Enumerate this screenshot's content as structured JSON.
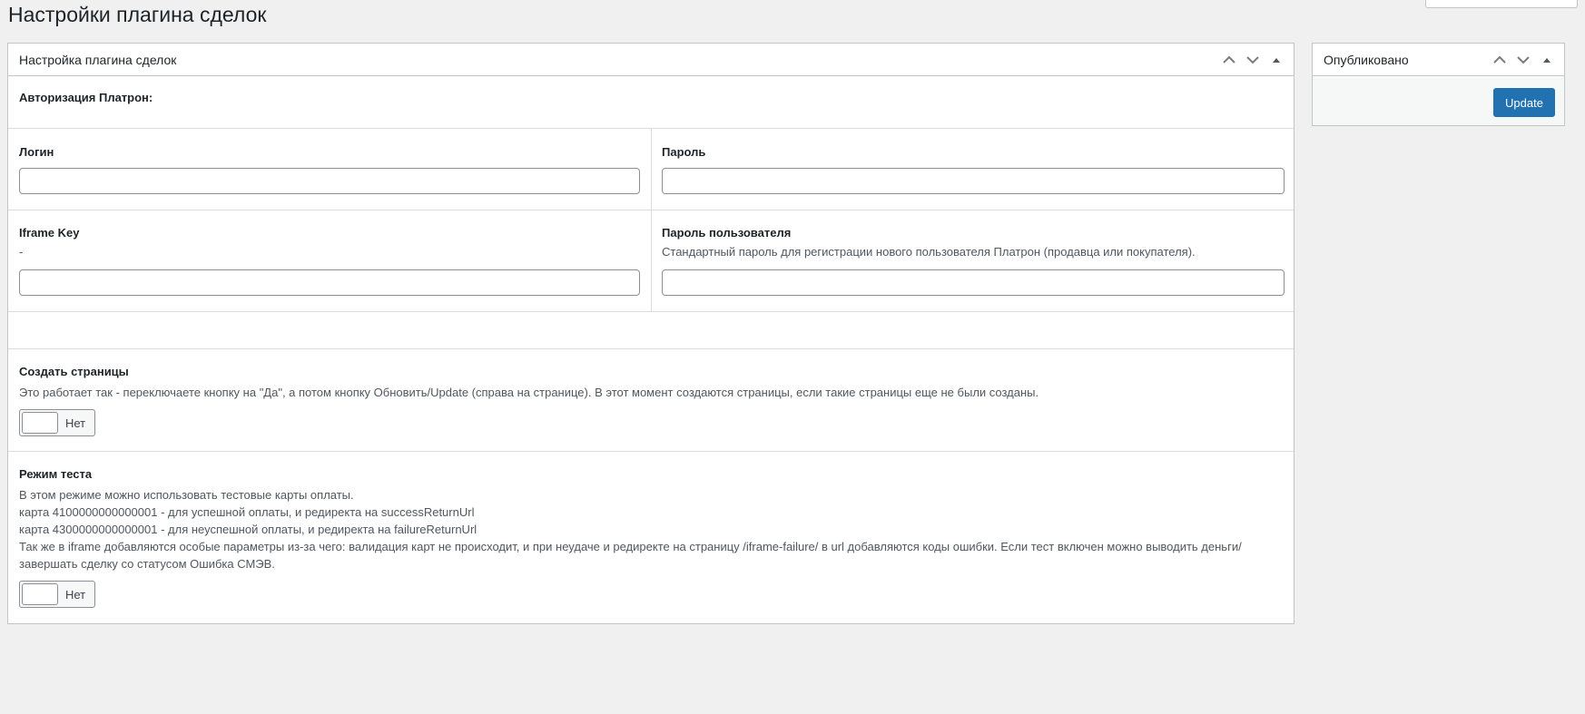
{
  "page": {
    "title": "Настройки плагина сделок"
  },
  "main_box": {
    "title": "Настройка плагина сделок",
    "auth_heading": "Авторизация Платрон:",
    "login": {
      "label": "Логин",
      "value": ""
    },
    "password": {
      "label": "Пароль",
      "value": ""
    },
    "iframe_key": {
      "label": "Iframe Key",
      "desc": "-",
      "value": ""
    },
    "user_password": {
      "label": "Пароль пользователя",
      "desc": "Стандартный пароль для регистрации нового пользователя Платрон (продавца или покупателя).",
      "value": ""
    },
    "create_pages": {
      "label": "Создать страницы",
      "desc": "Это работает так - переключаете кнопку на \"Да\", а потом кнопку Обновить/Update (справа на странице). В этот момент создаются страницы, если такие страницы еще не были созданы.",
      "toggle_label": "Нет"
    },
    "test_mode": {
      "label": "Режим теста",
      "desc_lines": [
        "В этом режиме можно использовать тестовые карты оплаты.",
        "карта 4100000000000001 - для успешной оплаты, и редиректа на successReturnUrl",
        "карта 4300000000000001 - для неуспешной оплаты, и редиректа на failureReturnUrl",
        "Так же в iframe добавляются особые параметры из-за чего: валидация карт не происходит, и при неудаче и редиректе на страницу /iframe-failure/ в url добавляются коды ошибки. Если тест включен можно выводить деньги/",
        "завершать сделку со статусом Ошибка СМЭВ."
      ],
      "toggle_label": "Нет"
    }
  },
  "side_box": {
    "title": "Опубликовано",
    "update_label": "Update"
  },
  "colors": {
    "background": "#f0f0f1",
    "primary_button": "#2271b1",
    "border": "#c3c4c7"
  }
}
